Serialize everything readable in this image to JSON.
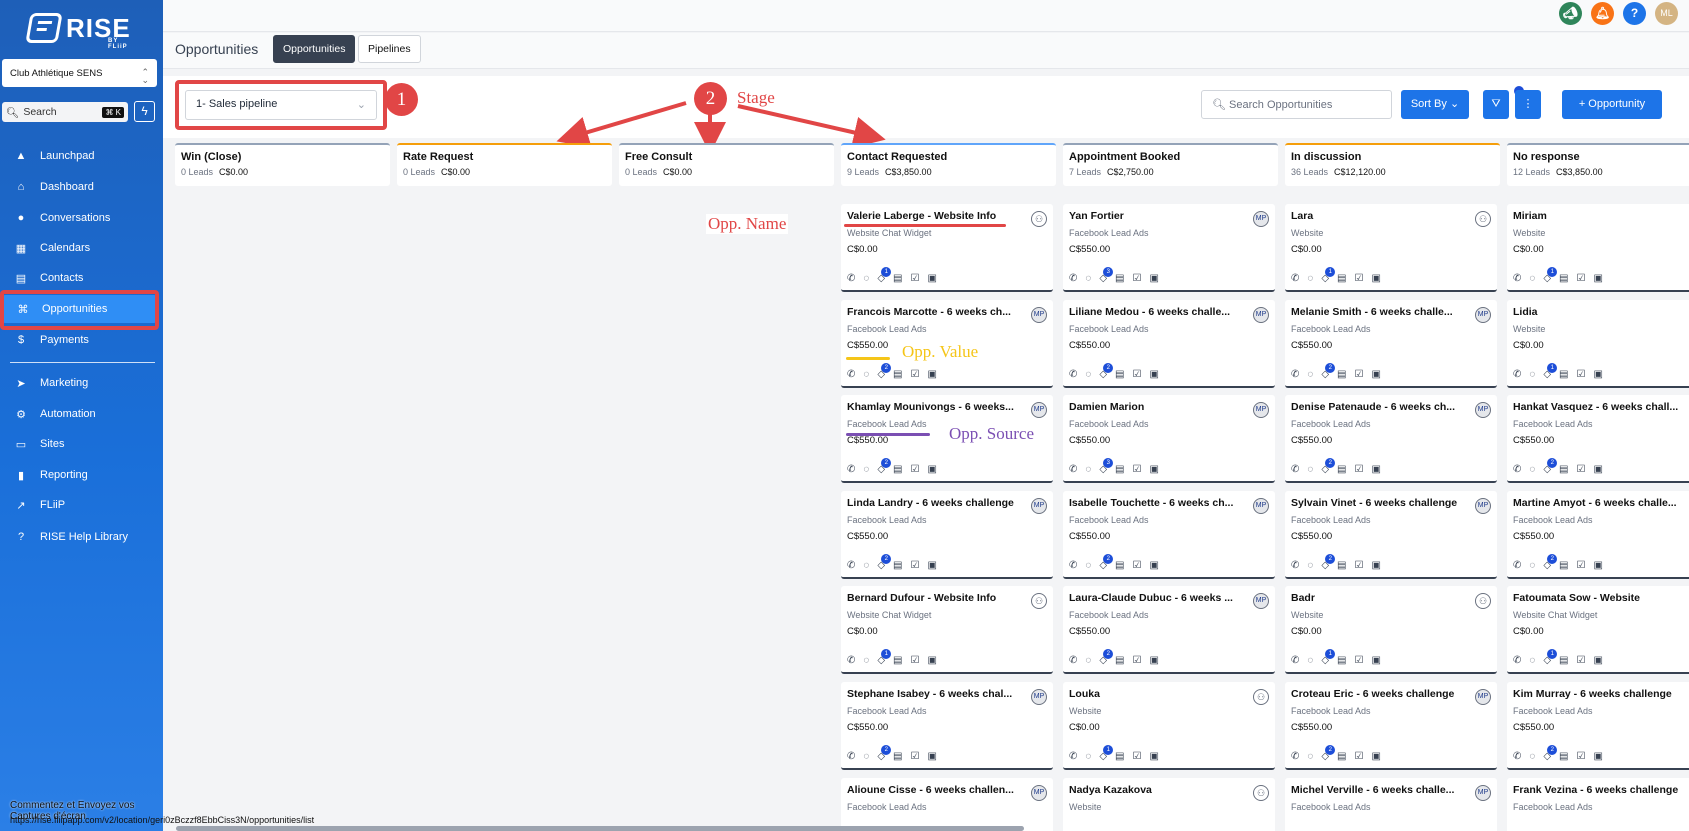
{
  "brand": {
    "name": "RISE",
    "sub": "BY FLiiP"
  },
  "account": "Club Athlétique SENS",
  "search": {
    "placeholder": "Search",
    "shortcut": "⌘ K"
  },
  "nav": [
    {
      "label": "Launchpad",
      "icon": "rocket-icon"
    },
    {
      "label": "Dashboard",
      "icon": "home-icon"
    },
    {
      "label": "Conversations",
      "icon": "chat-icon"
    },
    {
      "label": "Calendars",
      "icon": "calendar-icon"
    },
    {
      "label": "Contacts",
      "icon": "contacts-icon"
    },
    {
      "label": "Opportunities",
      "icon": "opportunities-icon"
    },
    {
      "label": "Payments",
      "icon": "payments-icon"
    },
    {
      "label": "Marketing",
      "icon": "send-icon"
    },
    {
      "label": "Automation",
      "icon": "automation-icon"
    },
    {
      "label": "Sites",
      "icon": "sites-icon"
    },
    {
      "label": "Reporting",
      "icon": "chart-icon"
    },
    {
      "label": "FLiiP",
      "icon": "external-icon"
    },
    {
      "label": "RISE Help Library",
      "icon": "help-icon"
    }
  ],
  "page": {
    "title": "Opportunities",
    "tabs": [
      "Opportunities",
      "Pipelines"
    ]
  },
  "controls": {
    "pipeline": "1- Sales pipeline",
    "search_placeholder": "Search Opportunities",
    "sort": "Sort By",
    "add": "+ Opportunity"
  },
  "annotations": {
    "one": "1",
    "two": "2",
    "stage": "Stage",
    "opp_name": "Opp. Name",
    "opp_value": "Opp. Value",
    "opp_source": "Opp. Source"
  },
  "user_initials": "ML",
  "columns": [
    {
      "name": "Win (Close)",
      "leads": "0 Leads",
      "value": "C$0.00"
    },
    {
      "name": "Rate Request",
      "leads": "0 Leads",
      "value": "C$0.00"
    },
    {
      "name": "Free Consult",
      "leads": "0 Leads",
      "value": "C$0.00"
    },
    {
      "name": "Contact Requested",
      "leads": "9 Leads",
      "value": "C$3,850.00"
    },
    {
      "name": "Appointment Booked",
      "leads": "7 Leads",
      "value": "C$2,750.00"
    },
    {
      "name": "In discussion",
      "leads": "36 Leads",
      "value": "C$12,120.00"
    },
    {
      "name": "No response",
      "leads": "12 Leads",
      "value": "C$3,850.00"
    }
  ],
  "cards": [
    [
      {
        "name": "Valerie Laberge - Website Info",
        "source": "Website Chat Widget",
        "value": "C$0.00",
        "av": "",
        "badge": "1"
      },
      {
        "name": "Francois Marcotte - 6 weeks ch...",
        "source": "Facebook Lead Ads",
        "value": "C$550.00",
        "av": "MP",
        "badge": "2"
      },
      {
        "name": "Khamlay Mounivongs - 6 weeks...",
        "source": "Facebook Lead Ads",
        "value": "C$550.00",
        "av": "MP",
        "badge": "2"
      },
      {
        "name": "Linda Landry - 6 weeks challenge",
        "source": "Facebook Lead Ads",
        "value": "C$550.00",
        "av": "MP",
        "badge": "2"
      },
      {
        "name": "Bernard Dufour - Website Info",
        "source": "Website Chat Widget",
        "value": "C$0.00",
        "av": "",
        "badge": "1"
      },
      {
        "name": "Stephane Isabey - 6 weeks chal...",
        "source": "Facebook Lead Ads",
        "value": "C$550.00",
        "av": "MP",
        "badge": "2"
      },
      {
        "name": "Alioune Cisse - 6 weeks challen...",
        "source": "Facebook Lead Ads",
        "value": "",
        "av": "MP",
        "badge": ""
      }
    ],
    [
      {
        "name": "Yan Fortier",
        "source": "Facebook Lead Ads",
        "value": "C$550.00",
        "av": "MP",
        "badge": "3"
      },
      {
        "name": "Liliane Medou - 6 weeks challe...",
        "source": "Facebook Lead Ads",
        "value": "C$550.00",
        "av": "MP",
        "badge": "2"
      },
      {
        "name": "Damien Marion",
        "source": "Facebook Lead Ads",
        "value": "C$550.00",
        "av": "MP",
        "badge": "3"
      },
      {
        "name": "Isabelle Touchette - 6 weeks ch...",
        "source": "Facebook Lead Ads",
        "value": "C$550.00",
        "av": "MP",
        "badge": "2"
      },
      {
        "name": "Laura-Claude Dubuc - 6 weeks ...",
        "source": "Facebook Lead Ads",
        "value": "C$550.00",
        "av": "MP",
        "badge": "2"
      },
      {
        "name": "Louka",
        "source": "Website",
        "value": "C$0.00",
        "av": "",
        "badge": "1"
      },
      {
        "name": "Nadya Kazakova",
        "source": "Website",
        "value": "",
        "av": "",
        "badge": ""
      }
    ],
    [
      {
        "name": "Lara",
        "source": "Website",
        "value": "C$0.00",
        "av": "",
        "badge": "1"
      },
      {
        "name": "Melanie Smith - 6 weeks challe...",
        "source": "Facebook Lead Ads",
        "value": "C$550.00",
        "av": "MP",
        "badge": "2"
      },
      {
        "name": "Denise Patenaude - 6 weeks ch...",
        "source": "Facebook Lead Ads",
        "value": "C$550.00",
        "av": "MP",
        "badge": "2"
      },
      {
        "name": "Sylvain Vinet - 6 weeks challenge",
        "source": "Facebook Lead Ads",
        "value": "C$550.00",
        "av": "MP",
        "badge": "2"
      },
      {
        "name": "Badr",
        "source": "Website",
        "value": "C$0.00",
        "av": "",
        "badge": "1"
      },
      {
        "name": "Croteau Eric - 6 weeks challenge",
        "source": "Facebook Lead Ads",
        "value": "C$550.00",
        "av": "MP",
        "badge": "2"
      },
      {
        "name": "Michel Verville - 6 weeks challe...",
        "source": "Facebook Lead Ads",
        "value": "",
        "av": "MP",
        "badge": ""
      }
    ],
    [
      {
        "name": "Miriam",
        "source": "Website",
        "value": "C$0.00",
        "av": "",
        "badge": "1"
      },
      {
        "name": "Lidia",
        "source": "Website",
        "value": "C$0.00",
        "av": "",
        "badge": "1"
      },
      {
        "name": "Hankat Vasquez - 6 weeks chall...",
        "source": "Facebook Lead Ads",
        "value": "C$550.00",
        "av": "",
        "badge": "2"
      },
      {
        "name": "Martine Amyot - 6 weeks challe...",
        "source": "Facebook Lead Ads",
        "value": "C$550.00",
        "av": "",
        "badge": "2"
      },
      {
        "name": "Fatoumata Sow - Website",
        "source": "Website Chat Widget",
        "value": "C$0.00",
        "av": "",
        "badge": "1"
      },
      {
        "name": "Kim Murray - 6 weeks challenge",
        "source": "Facebook Lead Ads",
        "value": "C$550.00",
        "av": "",
        "badge": "2"
      },
      {
        "name": "Frank Vezina - 6 weeks challenge",
        "source": "Facebook Lead Ads",
        "value": "",
        "av": "",
        "badge": ""
      }
    ]
  ],
  "footer": {
    "caption": "Commentez et Envoyez vos Captures d'écran",
    "url": "https://rise.fliipapp.com/v2/location/geri0zBczzf8EbbCiss3N/opportunities/list"
  },
  "colors": {
    "accent": "#1d74e8",
    "annotation_red": "#e14646",
    "annotation_yellow": "#f5c518",
    "annotation_purple": "#7b4fb3"
  }
}
